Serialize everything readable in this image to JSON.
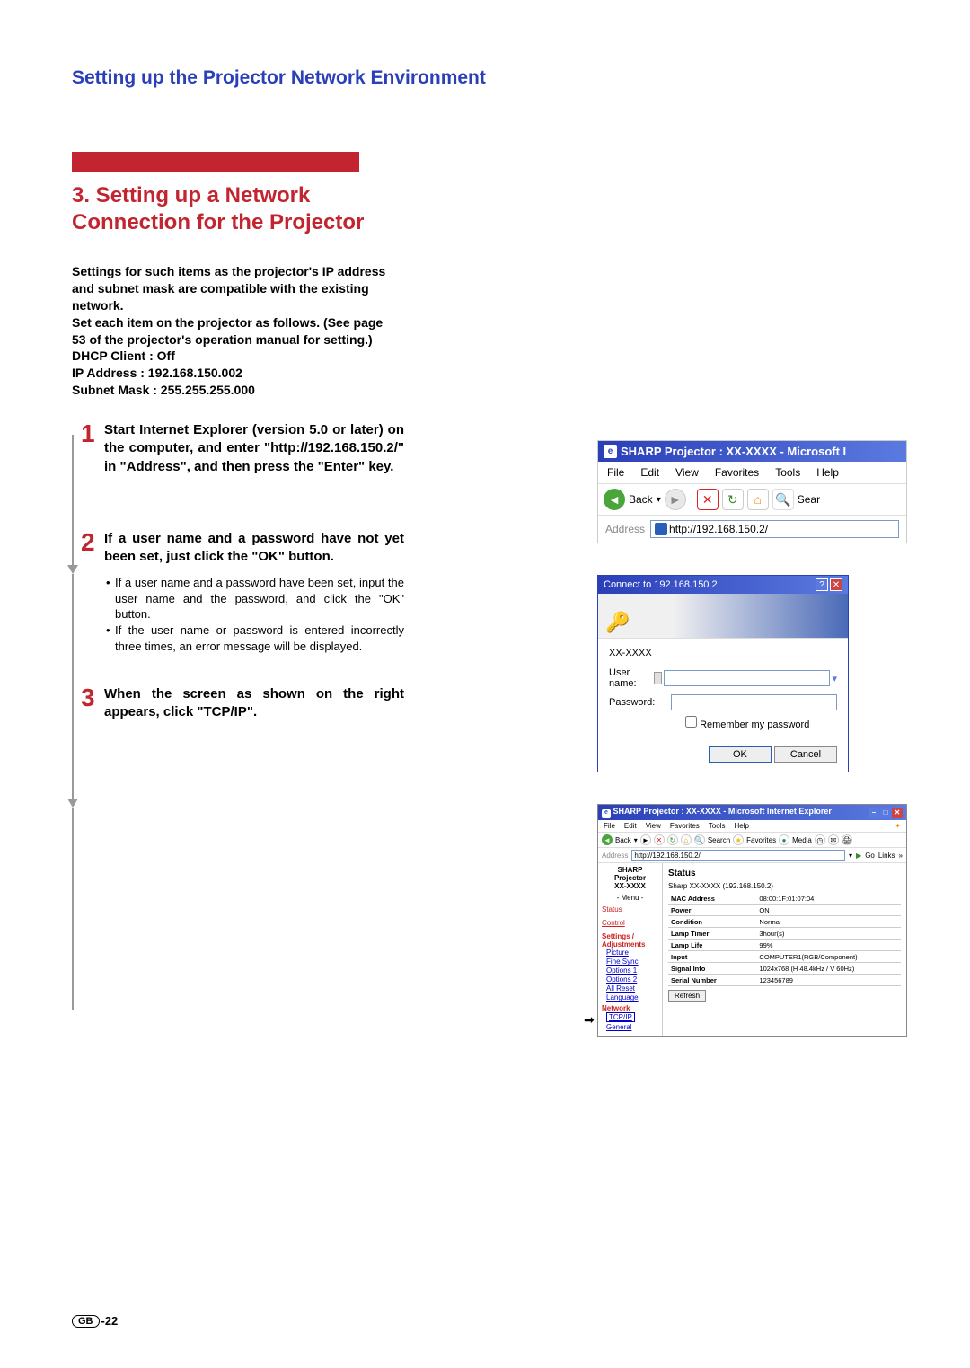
{
  "header": "Setting up the Projector Network Environment",
  "title": "3. Setting up a Network Connection for the Projector",
  "intro": "Settings for such items as the projector's IP address and subnet mask are compatible with the existing network.\nSet each item on the projector as follows. (See page 53 of the projector's operation manual for setting.)\nDHCP Client : Off\nIP Address : 192.168.150.002\nSubnet Mask : 255.255.255.000",
  "steps": {
    "s1": {
      "num": "1",
      "title": "Start Internet Explorer (version 5.0 or later) on the computer, and enter \"http://192.168.150.2/\" in \"Address\", and then press the \"Enter\" key."
    },
    "s2": {
      "num": "2",
      "title": "If a user name and a password have not yet been set, just click the \"OK\" button.",
      "b1": "If a user name and a password have been set, input the user name and the password, and click the \"OK\" button.",
      "b2": "If the user name or password is entered incorrectly three times, an error message will be displayed."
    },
    "s3": {
      "num": "3",
      "title": "When the screen as shown on the right appears, click \"TCP/IP\"."
    }
  },
  "fig1": {
    "title": "SHARP Projector : XX-XXXX   - Microsoft I",
    "menu": [
      "File",
      "Edit",
      "View",
      "Favorites",
      "Tools",
      "Help"
    ],
    "back": "Back",
    "sear": "Sear",
    "addr_label": "Address",
    "url": "http://192.168.150.2/"
  },
  "fig2": {
    "title": "Connect to 192.168.150.2",
    "model": "XX-XXXX",
    "user_label": "User name:",
    "pass_label": "Password:",
    "remember": "Remember my password",
    "ok": "OK",
    "cancel": "Cancel"
  },
  "fig3": {
    "title": "SHARP Projector : XX-XXXX - Microsoft Internet Explorer",
    "menu": [
      "File",
      "Edit",
      "View",
      "Favorites",
      "Tools",
      "Help"
    ],
    "back": "Back",
    "search": "Search",
    "fav": "Favorites",
    "media": "Media",
    "addr_label": "Address",
    "url": "http://192.168.150.2/",
    "go": "Go",
    "links": "Links",
    "side_header": "SHARP\nProjector\nXX-XXXX",
    "side_menu": "- Menu -",
    "side": {
      "status": "Status",
      "control": "Control",
      "settings": "Settings / Adjustments",
      "picture": "Picture",
      "fine": "Fine Sync",
      "opt1": "Options 1",
      "opt2": "Options 2",
      "reset": "All Reset",
      "lang": "Language",
      "network": "Network",
      "tcpip": "TCP/IP",
      "general": "General"
    },
    "content": {
      "h": "Status",
      "sub": "Sharp XX-XXXX    (192.168.150.2)",
      "rows": [
        [
          "MAC Address",
          "08:00:1F:01:07:04"
        ],
        [
          "Power",
          "ON"
        ],
        [
          "Condition",
          "Normal"
        ],
        [
          "Lamp Timer",
          "3hour(s)"
        ],
        [
          "Lamp Life",
          "99%"
        ],
        [
          "Input",
          "COMPUTER1(RGB/Component)"
        ],
        [
          "Signal Info",
          "1024x768 (H 48.4kHz / V 60Hz)"
        ],
        [
          "Serial Number",
          "123456789"
        ]
      ],
      "refresh": "Refresh"
    }
  },
  "footer": {
    "gb": "GB",
    "page": "-22"
  }
}
